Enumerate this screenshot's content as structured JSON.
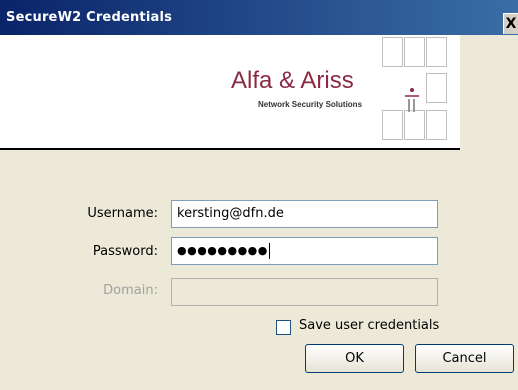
{
  "window": {
    "title": "SecureW2 Credentials",
    "close_label": "X"
  },
  "banner": {
    "logo_name": "Alfa & Ariss",
    "logo_tagline": "Network Security Solutions",
    "brand_color": "#8a2a45"
  },
  "form": {
    "username_label": "Username:",
    "username_value": "kersting@dfn.de",
    "password_label": "Password:",
    "password_masked": "●●●●●●●●●",
    "domain_label": "Domain:",
    "domain_value": ""
  },
  "options": {
    "save_credentials_label": "Save user credentials",
    "save_credentials_checked": false
  },
  "buttons": {
    "ok_label": "OK",
    "cancel_label": "Cancel"
  }
}
